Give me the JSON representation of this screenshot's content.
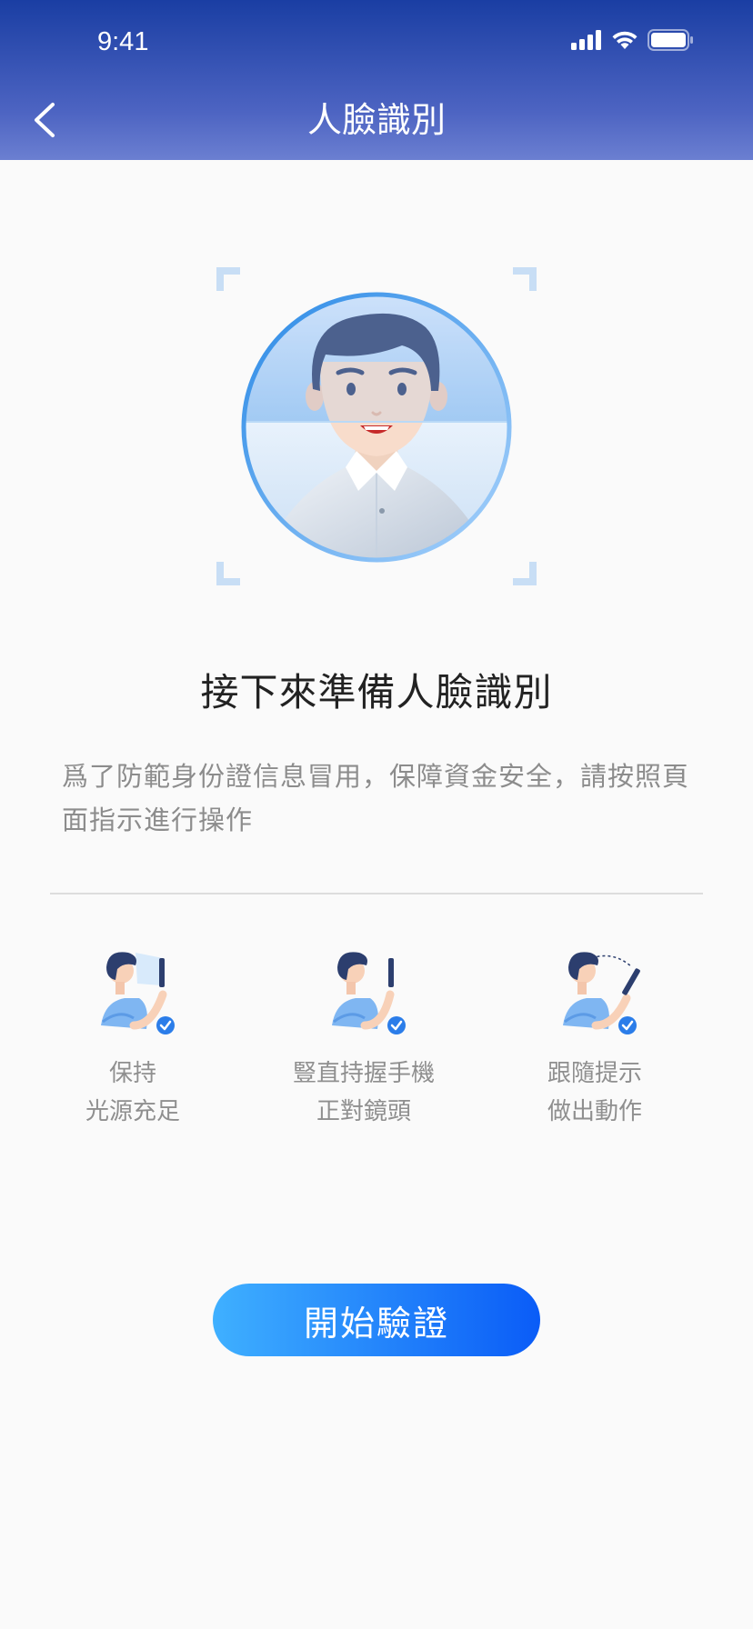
{
  "status_bar": {
    "time": "9:41"
  },
  "header": {
    "title": "人臉識別"
  },
  "main": {
    "title": "接下來準備人臉識別",
    "description": "爲了防範身份證信息冒用，保障資金安全，請按照頁面指示進行操作"
  },
  "tips": [
    {
      "line1": "保持",
      "line2": "光源充足"
    },
    {
      "line1": "豎直持握手機",
      "line2": "正對鏡頭"
    },
    {
      "line1": "跟隨提示",
      "line2": "做出動作"
    }
  ],
  "start_button": {
    "label": "開始驗證"
  },
  "colors": {
    "accent": "#0a5cf7",
    "header": "#3a55b8"
  }
}
